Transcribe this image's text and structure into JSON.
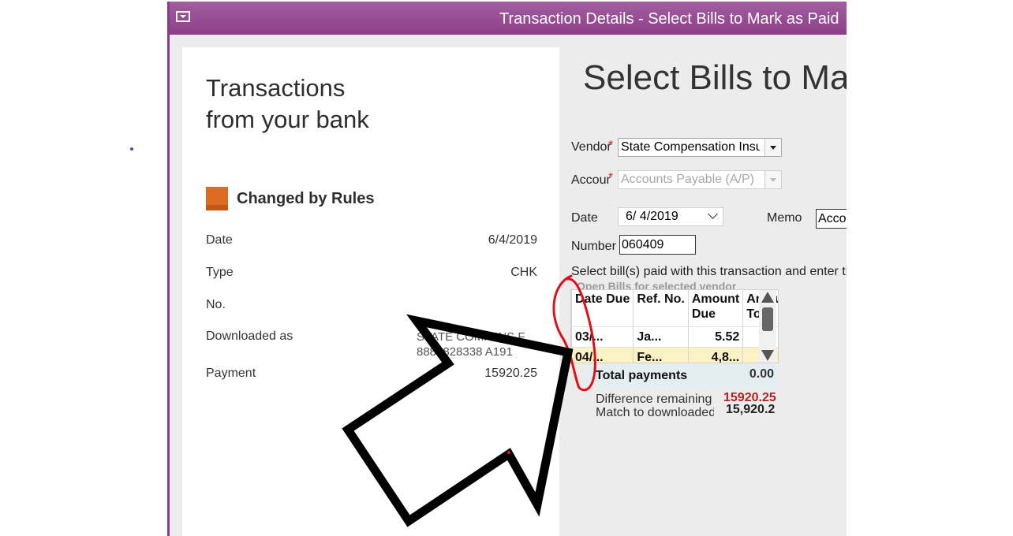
{
  "window": {
    "title": "Transaction Details - Select Bills to Mark as Paid"
  },
  "bank": {
    "title_line1": "Transactions",
    "title_line2": "from your bank",
    "rule_status": "Changed by Rules",
    "rows": {
      "date": {
        "label": "Date",
        "value": "6/4/2019"
      },
      "type": {
        "label": "Type",
        "value": "CHK"
      },
      "no": {
        "label": "No.",
        "value": ""
      },
      "downloaded": {
        "label": "Downloaded as",
        "value_line1": "STATE COMP INS F",
        "value_line2": "8884828338 A191"
      },
      "payment": {
        "label": "Payment",
        "value": "15920.25"
      }
    }
  },
  "form": {
    "heading": "Select Bills to Mark as Paid",
    "vendor_label": "Vendor",
    "vendor_value": "State Compensation Insurance Fund",
    "account_label": "Account",
    "account_value": "Accounts Payable (A/P)",
    "date_label": "Date",
    "date_value": "6/  4/2019",
    "memo_label": "Memo",
    "memo_value": "Account",
    "number_label": "Number",
    "number_value": "060409",
    "instruction": "Select bill(s) paid with this transaction and enter the amount",
    "open_bills_caption": "Open Bills for selected vendor"
  },
  "bills": {
    "columns": [
      "Date Due",
      "Ref. No.",
      "Amount Due",
      "Amount To"
    ],
    "rows": [
      {
        "date_due": "03/...",
        "ref_no": "Ja...",
        "amount_due": "5.52",
        "amount_to": ""
      },
      {
        "date_due": "04/...",
        "ref_no": "Fe...",
        "amount_due": "4,8...",
        "amount_to": ""
      }
    ]
  },
  "totals": {
    "total_label": "Total payments",
    "total_value": "0.00",
    "difference_label": "Difference remaining",
    "difference_value": "15920.25",
    "match_label": "Match to downloaded amount",
    "match_value": "15,920.2"
  },
  "colors": {
    "titlebar": "#8b3e87",
    "rule_chip": "#de6b21",
    "difference": "#b22222",
    "highlight_row": "#fbf2c6",
    "annotation_red": "#e0101a",
    "annotation_black": "#000000"
  }
}
